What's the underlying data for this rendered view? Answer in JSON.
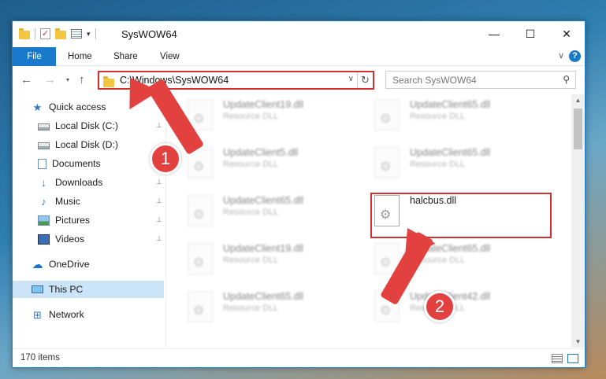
{
  "titlebar": {
    "title": "SysWOW64",
    "quick_access_icons": [
      "folder-icon",
      "properties-check-icon",
      "folder-icon",
      "properties-icon",
      "dropdown-icon"
    ],
    "minimize": "—",
    "maximize": "☐",
    "close": "✕"
  },
  "ribbon": {
    "tabs": [
      "File",
      "Home",
      "Share",
      "View"
    ],
    "expand_glyph": "∨",
    "help_glyph": "?"
  },
  "navbar": {
    "back": "←",
    "forward": "→",
    "recent": "▾",
    "up": "↑",
    "address": "C:\\Windows\\SysWOW64",
    "chevron": "∨",
    "refresh": "↻",
    "search_placeholder": "Search SysWOW64",
    "search_glyph": "⚲"
  },
  "sidebar": {
    "items": [
      {
        "label": "Quick access",
        "icon": "star-icon",
        "pinned": false
      },
      {
        "label": "Local Disk (C:)",
        "icon": "drive-icon",
        "pinned": true
      },
      {
        "label": "Local Disk (D:)",
        "icon": "drive-icon",
        "pinned": false
      },
      {
        "label": "Documents",
        "icon": "documents-icon",
        "pinned": false
      },
      {
        "label": "Downloads",
        "icon": "downloads-icon",
        "pinned": true
      },
      {
        "label": "Music",
        "icon": "music-icon",
        "pinned": true
      },
      {
        "label": "Pictures",
        "icon": "pictures-icon",
        "pinned": true
      },
      {
        "label": "Videos",
        "icon": "videos-icon",
        "pinned": true
      },
      {
        "label": "OneDrive",
        "icon": "onedrive-icon",
        "pinned": false
      },
      {
        "label": "This PC",
        "icon": "this-pc-icon",
        "pinned": false,
        "selected": true
      },
      {
        "label": "Network",
        "icon": "network-icon",
        "pinned": false
      }
    ],
    "pin_glyph": "📌"
  },
  "files": [
    {
      "name": "UpdateClient19.dll",
      "type": "Resource DLL",
      "blurred": true
    },
    {
      "name": "UpdateClient65.dll",
      "type": "Resource DLL",
      "blurred": true
    },
    {
      "name": "UpdateClient5.dll",
      "type": "Resource DLL",
      "blurred": true
    },
    {
      "name": "UpdateClient65.dll",
      "type": "Resource DLL",
      "blurred": true
    },
    {
      "name": "UpdateClient65.dll",
      "type": "Resource DLL",
      "blurred": true
    },
    {
      "name": "halcbus.dll",
      "type": "",
      "blurred": false,
      "highlighted": true
    },
    {
      "name": "UpdateClient19.dll",
      "type": "Resource DLL",
      "blurred": true
    },
    {
      "name": "UpdateClient65.dll",
      "type": "Resource DLL",
      "blurred": true
    },
    {
      "name": "UpdateClient65.dll",
      "type": "Resource DLL",
      "blurred": true
    },
    {
      "name": "UpdateClient42.dll",
      "type": "Resource DLL",
      "blurred": true
    }
  ],
  "status": {
    "item_count": "170 items"
  },
  "annotations": {
    "step1": "1",
    "step2": "2"
  },
  "colors": {
    "accent": "#1979ca",
    "highlight_border": "#d03030",
    "annotation": "#e3413f",
    "selected_bg": "#cce4f7"
  }
}
